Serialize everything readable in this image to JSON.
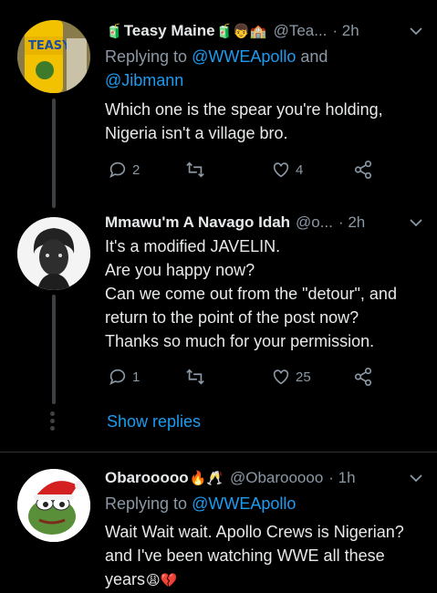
{
  "tweets": [
    {
      "name": "Teasy Maine",
      "handle": "@Tea...",
      "time": "· 2h",
      "replying_prefix": "Replying to ",
      "replying_mention1": "@WWEApollo",
      "replying_and": " and",
      "replying_mention2": "@Jibmann",
      "text": "Which one is the spear you're holding, Nigeria isn't a village bro.",
      "replies": "2",
      "retweets": "",
      "likes": "4",
      "avatar_label": "TEASY"
    },
    {
      "name": "Mmawu'm A Navago Idah",
      "handle": "@o...",
      "time": "· 2h",
      "text_lines": [
        "It's a modified JAVELIN.",
        "Are you happy now?",
        "Can we come out from the \"detour\", and return to the point of the post now?",
        "Thanks so much for your permission."
      ],
      "replies": "1",
      "retweets": "",
      "likes": "25"
    },
    {
      "name": "Obarooooo",
      "handle": "@Obarooooo",
      "time": "· 1h",
      "replying_prefix": "Replying to ",
      "replying_mention1": "@WWEApollo",
      "text": "Wait Wait wait. Apollo Crews is Nigerian? and I've been watching WWE all these years"
    }
  ],
  "show_replies": "Show replies",
  "colors": {
    "accent": "#1d9bf0",
    "secondary": "#8b98a5",
    "background": "#000000"
  },
  "icons": [
    "reply-icon",
    "retweet-icon",
    "like-icon",
    "share-icon",
    "chevron-down-icon"
  ]
}
